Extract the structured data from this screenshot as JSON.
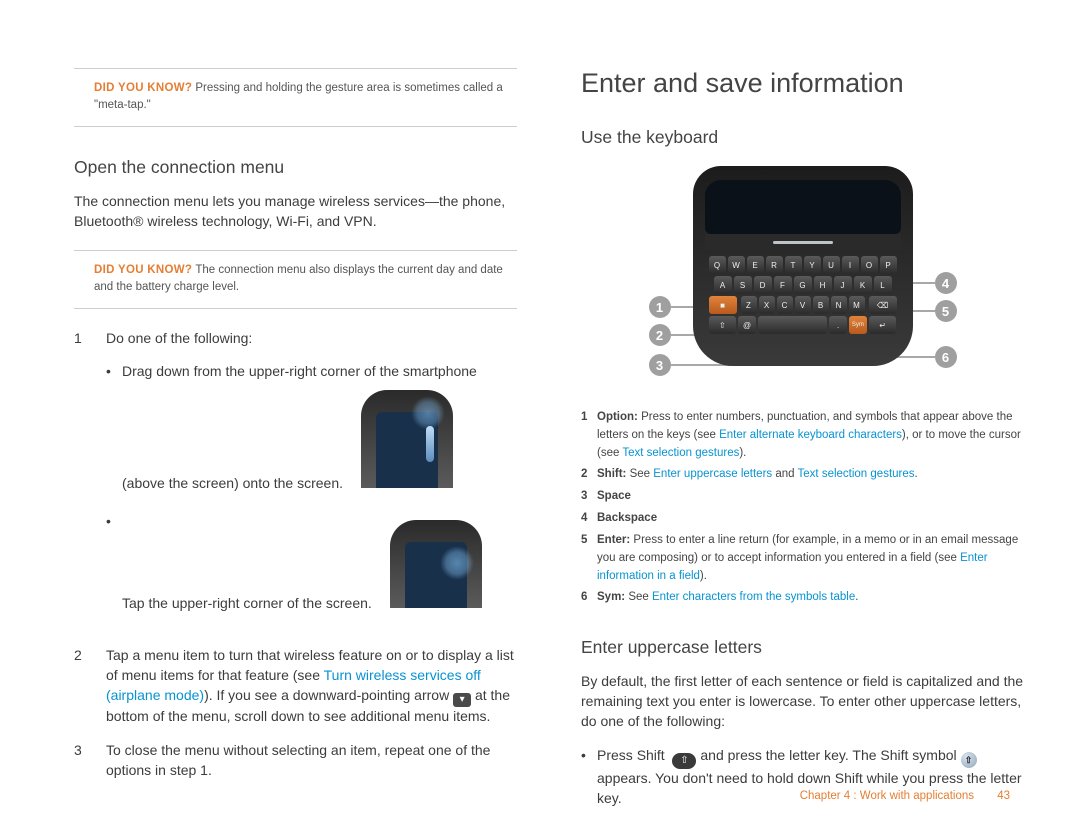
{
  "left": {
    "tip1_label": "DID YOU KNOW?",
    "tip1_body": "Pressing and holding the gesture area is sometimes called a \"meta-tap.\"",
    "h_openconn": "Open the connection menu",
    "p_connintro": "The connection menu lets you manage wireless services—the phone, Bluetooth® wireless technology, Wi-Fi, and VPN.",
    "tip2_label": "DID YOU KNOW?",
    "tip2_body": "The connection menu also displays the current day and date and the battery charge level.",
    "step1_num": "1",
    "step1_body": "Do one of the following:",
    "step1_b1": "Drag down from the upper-right corner of the smartphone (above the screen) onto the screen.",
    "step1_b2": "Tap the upper-right corner of the screen.",
    "step2_num": "2",
    "step2_a": "Tap a menu item to turn that wireless feature on or to display a list of menu items for that feature (see ",
    "step2_link": "Turn wireless services off (airplane mode)",
    "step2_b": "). If you see a downward-pointing arrow ",
    "step2_c": " at the bottom of the menu, scroll down to see additional menu items.",
    "step3_num": "3",
    "step3_body": "To close the menu without selecting an item, repeat one of the options in step 1."
  },
  "right": {
    "h_enter": "Enter and save information",
    "h_usekbd": "Use the keyboard",
    "callout1": "1",
    "callout2": "2",
    "callout3": "3",
    "callout4": "4",
    "callout5": "5",
    "callout6": "6",
    "keyrow1": [
      "Q",
      "W",
      "E",
      "R",
      "T",
      "Y",
      "U",
      "I",
      "O",
      "P"
    ],
    "keyrow2": [
      "A",
      "S",
      "D",
      "F",
      "G",
      "H",
      "J",
      "K",
      "L"
    ],
    "keyrow3": [
      "Z",
      "X",
      "C",
      "V",
      "B",
      "N",
      "M"
    ],
    "k1_n": "1",
    "k1_label": "Option:",
    "k1_a": " Press to enter numbers, punctuation, and symbols that appear above the letters on the keys (see ",
    "k1_link1": "Enter alternate keyboard characters",
    "k1_b": "), or to move the cursor (see ",
    "k1_link2": "Text selection gestures",
    "k1_c": ").",
    "k2_n": "2",
    "k2_label": "Shift:",
    "k2_a": " See ",
    "k2_link1": "Enter uppercase letters",
    "k2_b": " and ",
    "k2_link2": "Text selection gestures",
    "k2_c": ".",
    "k3_n": "3",
    "k3_label": "Space",
    "k4_n": "4",
    "k4_label": "Backspace",
    "k5_n": "5",
    "k5_label": "Enter:",
    "k5_a": " Press to enter a line return (for example, in a memo or in an email message you are composing) or to accept information you entered in a field (see ",
    "k5_link": "Enter information in a field",
    "k5_b": ").",
    "k6_n": "6",
    "k6_label": "Sym:",
    "k6_a": " See ",
    "k6_link": "Enter characters from the symbols table",
    "k6_b": ".",
    "h_upper": "Enter uppercase letters",
    "p_upper": "By default, the first letter of each sentence or field is capitalized and the remaining text you enter is lowercase. To enter other uppercase letters, do one of the following:",
    "b_shift_a": "Press ",
    "b_shift_b": "Shift",
    "b_shift_c": " and press the letter key. The Shift symbol ",
    "b_shift_d": " appears. You don't need to hold down Shift while you press the letter key."
  },
  "footer": {
    "chapter": "Chapter 4 : Work with applications",
    "page": "43"
  }
}
